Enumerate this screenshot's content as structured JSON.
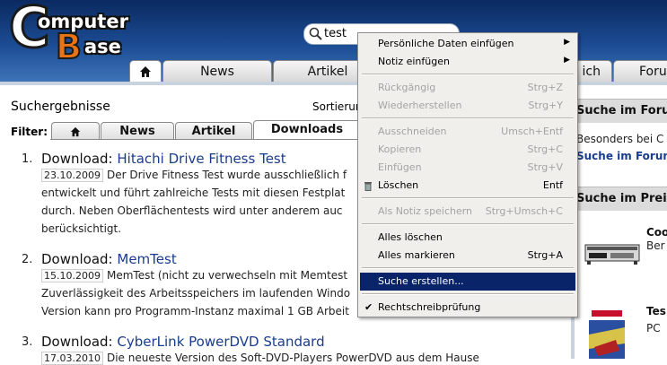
{
  "logo": {
    "line1_big": "C",
    "line1_rest": "omputer",
    "line2_big": "B",
    "line2_rest": "ase"
  },
  "search": {
    "value": "test"
  },
  "nav_tabs": [
    "News",
    "Artikel",
    "ich",
    "Foru"
  ],
  "content": {
    "results_title": "Suchergebnisse",
    "sort_label": "Sortierun",
    "filter_label": "Filter:",
    "filter_tabs": [
      "News",
      "Artikel",
      "Downloads"
    ],
    "results": [
      {
        "num": "1.",
        "prefix": "Download: ",
        "title": "Hitachi Drive Fitness Test",
        "date": "23.10.2009",
        "text1": "Der Drive Fitness Test wurde ausschließlich f",
        "text2": "entwickelt und führt zahlreiche Tests mit diesen Festplat",
        "text3": "durch. Neben Oberflächentests wird unter anderem auc",
        "text4": "berücksichtigt."
      },
      {
        "num": "2.",
        "prefix": "Download: ",
        "title": "MemTest",
        "date": "15.10.2009",
        "text1": "MemTest (nicht zu verwechseln mit Memtest",
        "text2": "Zuverlässigkeit des Arbeitsspeichers im laufenden Windo",
        "text3": "Version kann pro Programm-Instanz maximal 1 GB Arbeit"
      },
      {
        "num": "3.",
        "prefix": "Download: ",
        "title": "CyberLink PowerDVD Standard",
        "date": "17.03.2010",
        "text1": "Die neueste Version des Soft-DVD-Players PowerDVD aus dem Hause"
      }
    ]
  },
  "sidebar": {
    "band1": "Suche im Foru",
    "line1": "Besonders bei C",
    "line2": "Suche im Forum",
    "band2": "Suche im Preis",
    "prod1_title": "Coo",
    "prod1_sub": "Ber",
    "prod2_title": "Tes",
    "prod2_sub": "PC"
  },
  "context_menu": {
    "items": [
      {
        "label": "Persönliche Daten einfügen",
        "shortcut": "",
        "submenu": true
      },
      {
        "label": "Notiz einfügen",
        "shortcut": "",
        "submenu": true
      },
      {
        "label": "Rückgängig",
        "shortcut": "Strg+Z"
      },
      {
        "label": "Wiederherstellen",
        "shortcut": "Strg+Y"
      },
      {
        "label": "Ausschneiden",
        "shortcut": "Umsch+Entf"
      },
      {
        "label": "Kopieren",
        "shortcut": "Strg+C"
      },
      {
        "label": "Einfügen",
        "shortcut": "Strg+V"
      },
      {
        "label": "Löschen",
        "shortcut": "Entf"
      },
      {
        "label": "Als Notiz speichern",
        "shortcut": "Strg+Umsch+C"
      },
      {
        "label": "Alles löschen",
        "shortcut": ""
      },
      {
        "label": "Alles markieren",
        "shortcut": "Strg+A"
      },
      {
        "label": "Suche erstellen...",
        "shortcut": ""
      },
      {
        "label": "Rechtschreibprüfung",
        "shortcut": ""
      }
    ]
  },
  "colors": {
    "header_top": "#0a2a60",
    "header_bottom": "#3f74b8",
    "link": "#1a3c8c",
    "menu_highlight": "#0a246a",
    "logo_orange": "#e87418"
  }
}
